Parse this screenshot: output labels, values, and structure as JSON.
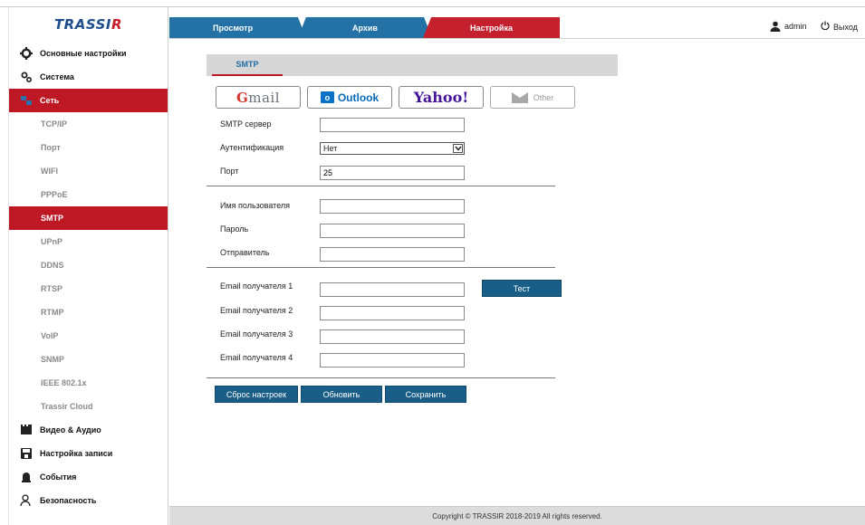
{
  "brand": {
    "logo_main": "TRASSI",
    "logo_accent": "R"
  },
  "sidebar": {
    "items": [
      {
        "label": "Основные настройки",
        "icon": "gear-icon"
      },
      {
        "label": "Система",
        "icon": "gears-icon"
      },
      {
        "label": "Сеть",
        "icon": "network-icon"
      }
    ],
    "sub_items": [
      "TCP/IP",
      "Порт",
      "WIFI",
      "PPPoE",
      "SMTP",
      "UPnP",
      "DDNS",
      "RTSP",
      "RTMP",
      "VoIP",
      "SNMP",
      "IEEE 802.1x",
      "Trassir Cloud"
    ],
    "bottom_items": [
      {
        "label": "Видео & Аудио",
        "icon": "video-icon"
      },
      {
        "label": "Настройка записи",
        "icon": "save-icon"
      },
      {
        "label": "События",
        "icon": "alarm-icon"
      },
      {
        "label": "Безопасность",
        "icon": "user-lock-icon"
      }
    ],
    "active_item": "Сеть",
    "active_sub_item": "SMTP"
  },
  "header": {
    "tabs": [
      "Просмотр",
      "Архив",
      "Настройка"
    ],
    "active_tab": "Настройка",
    "user": "admin",
    "logout": "Выход"
  },
  "content": {
    "subtab": "SMTP",
    "providers": {
      "gmail_g": "G",
      "gmail_rest": "mail",
      "outlook_box": "o",
      "outlook_text": "Outlook",
      "yahoo": "Yahoo!",
      "other": "Other"
    },
    "fields": {
      "smtp_server": {
        "label": "SMTP сервер",
        "value": ""
      },
      "auth": {
        "label": "Аутентификация",
        "value": "Нет"
      },
      "port": {
        "label": "Порт",
        "value": "25"
      },
      "username": {
        "label": "Имя пользователя",
        "value": ""
      },
      "password": {
        "label": "Пароль",
        "value": ""
      },
      "sender": {
        "label": "Отправитель",
        "value": ""
      },
      "recipient1": {
        "label": "Email получателя 1",
        "value": ""
      },
      "recipient2": {
        "label": "Email получателя 2",
        "value": ""
      },
      "recipient3": {
        "label": "Email получателя 3",
        "value": ""
      },
      "recipient4": {
        "label": "Email получателя 4",
        "value": ""
      }
    },
    "buttons": {
      "test": "Тест",
      "reset": "Сброс настроек",
      "refresh": "Обновить",
      "save": "Сохранить"
    }
  },
  "footer": {
    "text": "Copyright © TRASSIR 2018-2019 All rights reserved."
  },
  "colors": {
    "accent_red": "#bd1824",
    "tab_blue": "#2371a5",
    "button_blue": "#195e86"
  }
}
